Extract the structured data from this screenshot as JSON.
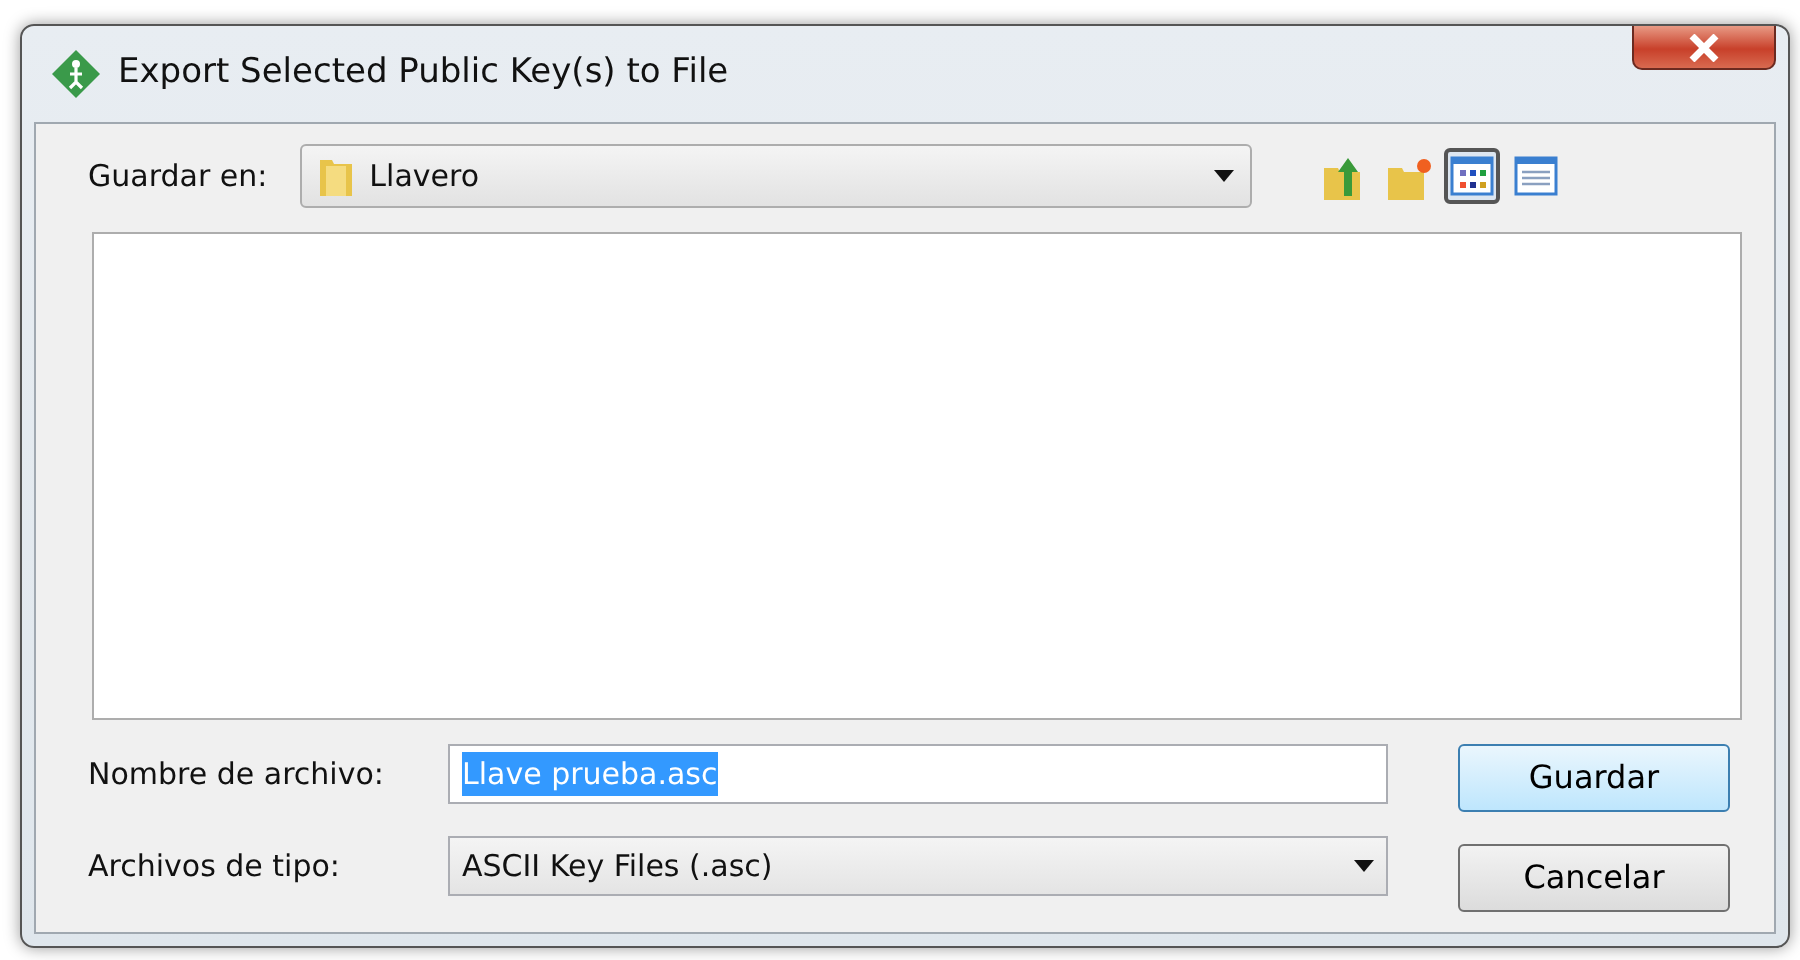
{
  "window": {
    "title": "Export Selected Public Key(s) to File"
  },
  "location": {
    "label": "Guardar en:",
    "value": "Llavero"
  },
  "toolbar": [
    {
      "kind": "up",
      "selected": false
    },
    {
      "kind": "new-folder",
      "selected": false
    },
    {
      "kind": "list-view",
      "selected": true
    },
    {
      "kind": "details-view",
      "selected": false
    }
  ],
  "file_name": {
    "label": "Nombre de archivo:",
    "value": "Llave prueba.asc",
    "text_selected": true
  },
  "file_type": {
    "label": "Archivos de tipo:",
    "value": "ASCII Key Files (.asc)"
  },
  "buttons": [
    {
      "label": "Guardar",
      "default": true
    },
    {
      "label": "Cancelar",
      "default": false
    }
  ]
}
